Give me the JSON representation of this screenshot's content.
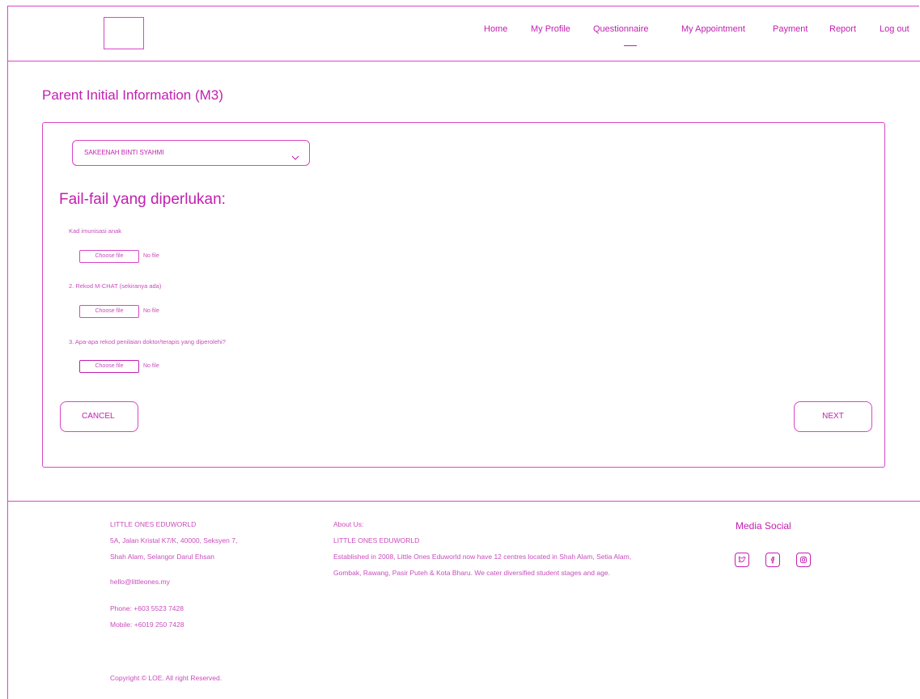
{
  "nav": {
    "home": "Home",
    "profile": "My Profile",
    "questionnaire": "Questionnaire",
    "appointment": "My Appointment",
    "payment": "Payment",
    "report": "Report",
    "logout": "Log out"
  },
  "page_title": "Parent Initial Information (M3)",
  "child_select": {
    "value": "SAKEENAH BINTI SYAHMI"
  },
  "section_title": "Fail-fail yang diperlukan:",
  "questions": [
    {
      "label": "Kad imunisasi anak",
      "button": "Choose file",
      "status": "No file"
    },
    {
      "label": "2. Rekod M-CHAT (sekiranya ada)",
      "button": "Choose file",
      "status": "No file"
    },
    {
      "label": "3. Apa-apa rekod penilaian doktor/terapis yang diperolehi?",
      "button": "Choose file",
      "status": "No file"
    }
  ],
  "actions": {
    "cancel": "CANCEL",
    "next": "NEXT"
  },
  "footer": {
    "company": "LITTLE ONES EDUWORLD",
    "address1": "5A, Jalan Kristal K7/K, 40000, Seksyen 7,",
    "address2": "Shah Alam, Selangor Darul Ehsan",
    "email": "hello@littleones.my",
    "phone": "Phone: +603 5523 7428",
    "mobile": "Mobile: +6019 250 7428",
    "copyright": "Copyright © LOE. All right Reserved.",
    "about_heading": "About Us:",
    "about_company": "LITTLE ONES EDUWORLD",
    "about_line1": "Established in 2008, Little Ones Eduworld now have 12 centres located in Shah Alam, Setia Alam,",
    "about_line2": "Gombak, Rawang, Pasir Puteh & Kota Bharu.  We cater diversified student stages and age.",
    "media_title": "Media Social",
    "social_icons": [
      "twitter-icon",
      "facebook-icon",
      "instagram-icon"
    ]
  },
  "colors": {
    "accent": "#d400b8",
    "border": "#d946c8"
  }
}
